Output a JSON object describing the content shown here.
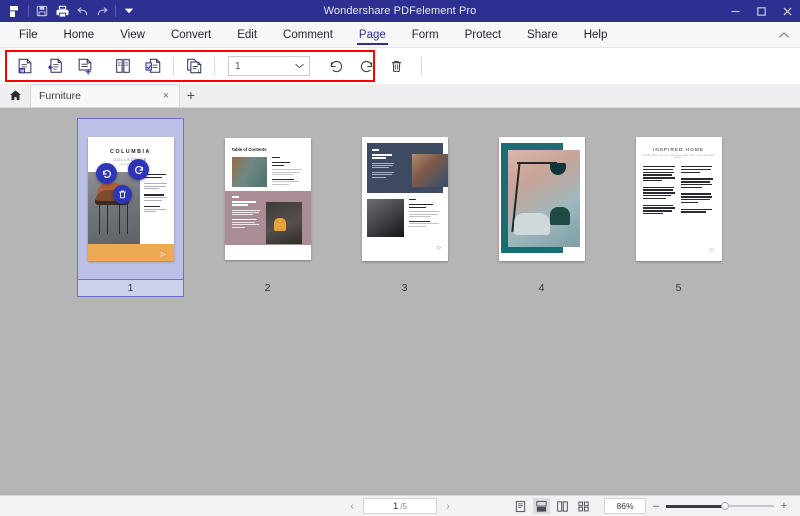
{
  "window": {
    "title": "Wondershare PDFelement Pro",
    "quick_access": [
      {
        "name": "app-logo-icon",
        "label": "PDFelement"
      },
      {
        "name": "save-icon",
        "label": "Save"
      },
      {
        "name": "print-icon",
        "label": "Print"
      },
      {
        "name": "undo-icon",
        "label": "Undo"
      },
      {
        "name": "redo-icon",
        "label": "Redo"
      },
      {
        "name": "customize-quick-access-icon",
        "label": "Customize Quick Access Toolbar"
      }
    ],
    "controls": [
      {
        "name": "minimize-button",
        "glyph": "–"
      },
      {
        "name": "maximize-button",
        "glyph": "□"
      },
      {
        "name": "close-button",
        "glyph": "×"
      }
    ]
  },
  "menu": {
    "items": [
      {
        "label": "File",
        "active": false
      },
      {
        "label": "Home",
        "active": false
      },
      {
        "label": "View",
        "active": false
      },
      {
        "label": "Convert",
        "active": false
      },
      {
        "label": "Edit",
        "active": false
      },
      {
        "label": "Comment",
        "active": false
      },
      {
        "label": "Page",
        "active": true
      },
      {
        "label": "Form",
        "active": false
      },
      {
        "label": "Protect",
        "active": false
      },
      {
        "label": "Share",
        "active": false
      },
      {
        "label": "Help",
        "active": false
      }
    ],
    "collapse_label": "˄"
  },
  "ribbon": {
    "highlighted": true,
    "highlight_color": "#ff0000",
    "buttons": [
      {
        "name": "page-boxes-button",
        "label": "Page Boxes"
      },
      {
        "name": "insert-page-button",
        "label": "Insert"
      },
      {
        "name": "add-page-button",
        "label": "Add"
      },
      {
        "name": "split-page-button",
        "label": "Split"
      },
      {
        "name": "extract-page-button",
        "label": "Extract"
      },
      {
        "name": "replace-page-button",
        "label": "Replace"
      }
    ],
    "page_select": {
      "value": "1",
      "caret": "⌄"
    },
    "rotate_left": {
      "name": "rotate-left-button",
      "label": "Rotate Left"
    },
    "rotate_right": {
      "name": "rotate-right-button",
      "label": "Rotate Right"
    },
    "delete": {
      "name": "delete-page-button",
      "label": "Delete"
    }
  },
  "doctabs": {
    "home_label": "Home",
    "tabs": [
      {
        "label": "Furniture",
        "close": "×"
      }
    ],
    "new_tab": "+"
  },
  "thumbnails": {
    "overlay_actions": [
      {
        "name": "thumb-rotate-left-button",
        "label": "Rotate Left"
      },
      {
        "name": "thumb-rotate-right-button",
        "label": "Rotate Right"
      },
      {
        "name": "thumb-delete-button",
        "label": "Delete Page"
      }
    ],
    "pages": [
      {
        "number": "1",
        "selected": true,
        "kind": "cover",
        "title": "COLUMBIA",
        "subtitle": "COLLECTIVE",
        "tagline": "INTERIOR 2021"
      },
      {
        "number": "2",
        "selected": false,
        "kind": "toc",
        "title": "Table of Contents"
      },
      {
        "number": "3",
        "selected": false,
        "kind": "navy-feature",
        "title": ""
      },
      {
        "number": "4",
        "selected": false,
        "kind": "photo-frame",
        "title": ""
      },
      {
        "number": "5",
        "selected": false,
        "kind": "article",
        "title": "INSPIRED HOME",
        "subtitle": "FURNITURE, DECOR, DESIGN IDEAS FOR YOUR MODERN HOME"
      }
    ]
  },
  "statusbar": {
    "prev": "‹",
    "next": "›",
    "current_page": "1",
    "total_pages": "/5",
    "view_modes": [
      {
        "name": "single-page-view-button",
        "label": "Single Page",
        "active": false
      },
      {
        "name": "continuous-view-button",
        "label": "Continuous",
        "active": true
      },
      {
        "name": "facing-view-button",
        "label": "Facing",
        "active": false
      },
      {
        "name": "thumbnail-grid-view-button",
        "label": "Thumbnails",
        "active": false
      }
    ],
    "zoom_value": "86%",
    "zoom_out": "–",
    "zoom_in": "+"
  },
  "colors": {
    "title_bar": "#2d3091",
    "accent": "#2d3091",
    "overlay_button": "#2e35b6",
    "canvas": "#b5b5b5",
    "highlight": "#ff0000",
    "selection": "#bcc0e6"
  }
}
